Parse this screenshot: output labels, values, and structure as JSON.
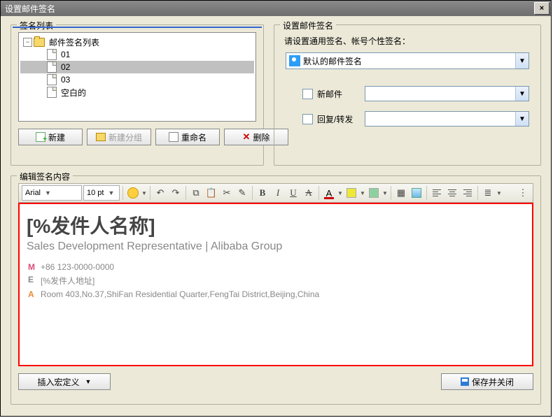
{
  "window": {
    "title": "设置邮件签名"
  },
  "panel_left": {
    "title": "签名列表",
    "tree_root": "邮件签名列表",
    "items": [
      "01",
      "02",
      "03",
      "空白的"
    ],
    "selected_index": 1,
    "buttons": {
      "new": "新建",
      "new_group": "新建分组",
      "rename": "重命名",
      "delete": "删除"
    }
  },
  "panel_right": {
    "title": "设置邮件签名",
    "prompt": "请设置通用签名、帐号个性签名：",
    "default_sig": "默认的邮件签名",
    "new_mail_label": "新邮件",
    "reply_fwd_label": "回复/转发"
  },
  "editor": {
    "title": "编辑签名内容",
    "font": "Arial",
    "size": "10 pt"
  },
  "signature": {
    "name": "[%发件人名称]",
    "title_line": "Sales Development Representative | Alibaba Group",
    "m_label": "M",
    "m_value": "+86 123-0000-0000",
    "e_label": "E",
    "e_value": "[%发件人地址]",
    "a_label": "A",
    "a_value": "Room 403,No.37,ShiFan Residential Quarter,FengTai District,Beijing,China"
  },
  "footer": {
    "insert_macro": "插入宏定义",
    "save_close": "保存并关闭"
  }
}
